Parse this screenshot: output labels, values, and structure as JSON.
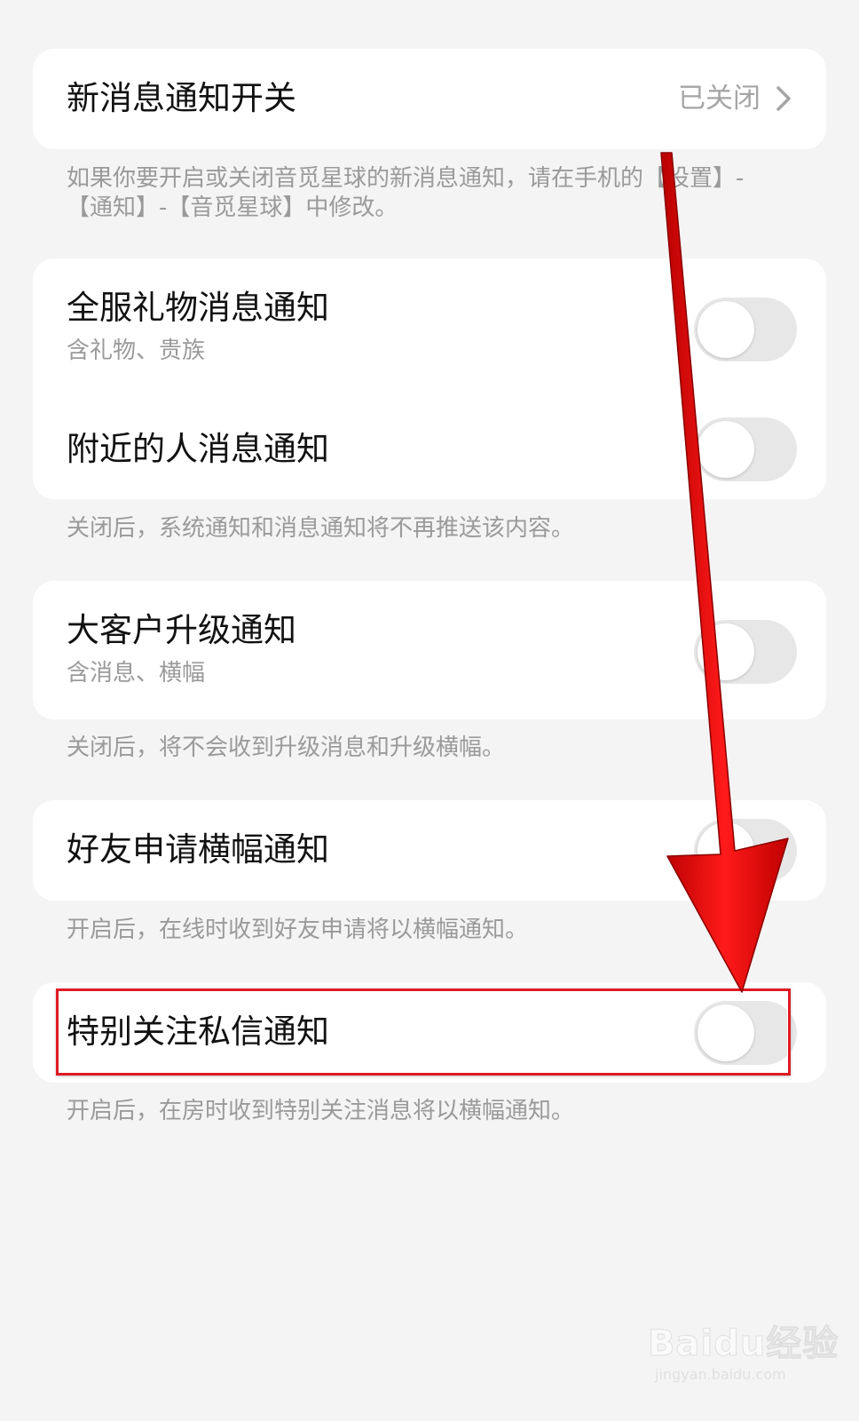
{
  "section1": {
    "title": "新消息通知开关",
    "status": "已关闭",
    "note": "如果你要开启或关闭音觅星球的新消息通知，请在手机的【设置】-【通知】-【音觅星球】中修改。"
  },
  "section2": {
    "items": [
      {
        "title": "全服礼物消息通知",
        "subtitle": "含礼物、贵族",
        "enabled": false
      },
      {
        "title": "附近的人消息通知",
        "enabled": false
      }
    ],
    "note": "关闭后，系统通知和消息通知将不再推送该内容。"
  },
  "section3": {
    "items": [
      {
        "title": "大客户升级通知",
        "subtitle": "含消息、横幅",
        "enabled": false
      }
    ],
    "note": "关闭后，将不会收到升级消息和升级横幅。"
  },
  "section4": {
    "items": [
      {
        "title": "好友申请横幅通知",
        "enabled": false
      }
    ],
    "note": "开启后，在线时收到好友申请将以横幅通知。"
  },
  "section5": {
    "items": [
      {
        "title": "特别关注私信通知",
        "enabled": false
      }
    ],
    "note": "开启后，在房时收到特别关注消息将以横幅通知。"
  },
  "icons": {
    "chevron": "chevron-right-icon",
    "arrow": "red-arrow-annotation",
    "highlight": "red-highlight-box"
  },
  "colors": {
    "background": "#f4f4f4",
    "card": "#ffffff",
    "toggle_off": "#e7e7e7",
    "annotation_red": "#e01b24",
    "secondary_text": "#9a9a9a"
  },
  "watermark": {
    "logo": "Baidu经验",
    "url": "jingyan.baidu.com"
  }
}
